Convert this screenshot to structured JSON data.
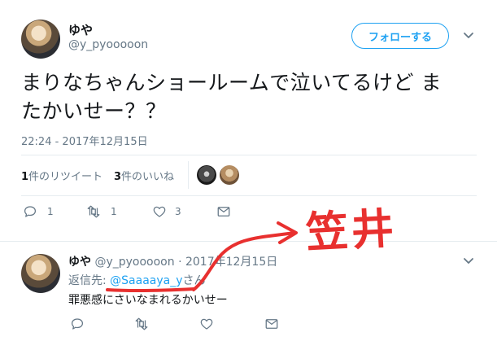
{
  "main_tweet": {
    "author_name": "ゆや",
    "author_handle": "@y_pyooooon",
    "follow_label": "フォローする",
    "text_line1": "まりなちゃんショールームで泣いてるけど ま",
    "text_line2": "たかいせー？？",
    "timestamp": "22:24 - 2017年12月15日",
    "retweets_count": "1",
    "retweets_label": "件のリツイート",
    "likes_count": "3",
    "likes_label": "件のいいね",
    "actions": {
      "reply": "1",
      "retweet": "1",
      "like": "3"
    }
  },
  "reply_tweet": {
    "author_name": "ゆや",
    "author_handle": "@y_pyooooon",
    "separator": "·",
    "date": "2017年12月15日",
    "reply_to_prefix": "返信先: ",
    "reply_to_handle": "@Saaaaya_y",
    "reply_to_suffix": "さん",
    "text": "罪悪感にさいなまれるかいせー"
  },
  "annotation": {
    "text": "笠井",
    "color": "#e8302f"
  },
  "colors": {
    "accent": "#1da1f2",
    "muted": "#657786",
    "divider": "#e6ecf0"
  }
}
